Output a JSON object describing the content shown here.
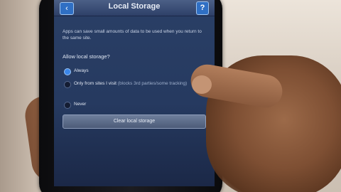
{
  "screen": {
    "title": "Local Storage",
    "back_icon": "chevron-left-icon",
    "back_glyph": "‹",
    "help_icon": "question-icon",
    "help_glyph": "?",
    "description": "Apps can save small amounts of data to be used when you return to the same site.",
    "question": "Allow local storage?",
    "options": [
      {
        "label": "Always",
        "note": "",
        "selected": true
      },
      {
        "label": "Only from sites I visit",
        "note": "(blocks 3rd parties/some tracking)",
        "selected": false
      },
      {
        "label": "Never",
        "note": "",
        "selected": false
      }
    ],
    "clear_button": "Clear local storage"
  },
  "colors": {
    "screen_bg": "#2a3f66",
    "accent": "#3b86e8",
    "skin": "#9c6a49"
  }
}
